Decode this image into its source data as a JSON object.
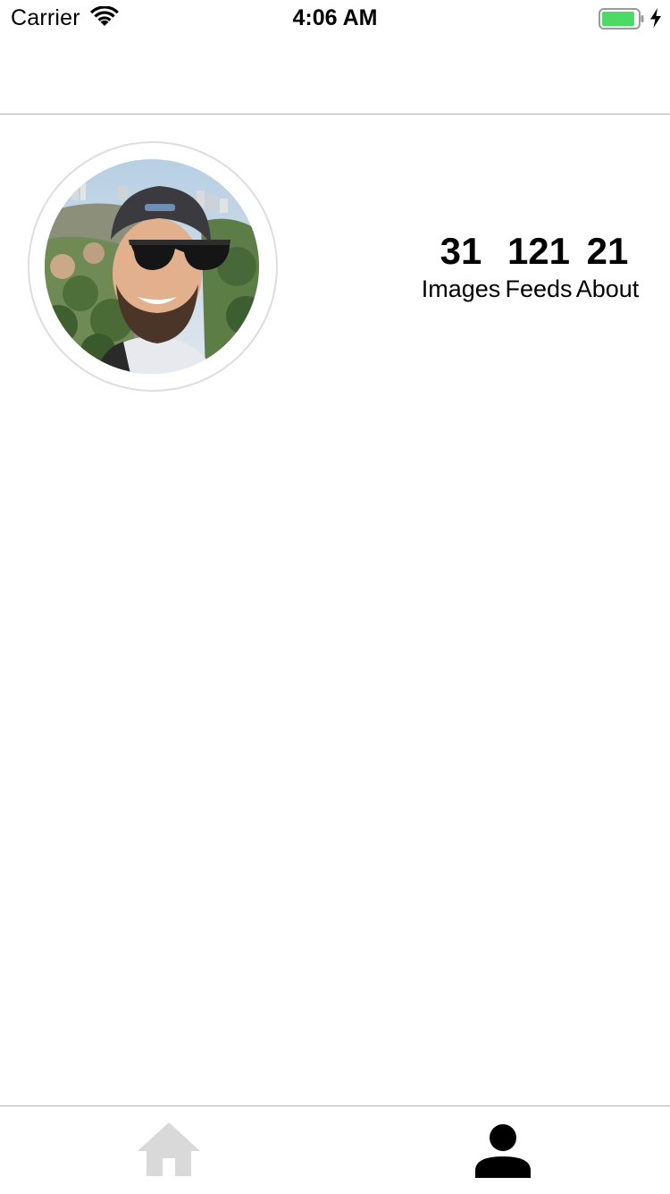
{
  "status_bar": {
    "carrier": "Carrier",
    "time": "4:06 AM",
    "battery_color": "#4cd964"
  },
  "profile": {
    "avatar_alt": "profile photo",
    "stats": [
      {
        "value": "31",
        "label": "Images"
      },
      {
        "value": "121",
        "label": "Feeds"
      },
      {
        "value": "21",
        "label": "About"
      }
    ]
  },
  "tab_bar": {
    "tabs": [
      {
        "icon": "home-icon",
        "active": false
      },
      {
        "icon": "person-icon",
        "active": true
      }
    ],
    "active_color": "#000000",
    "inactive_color": "#d9d9d9"
  }
}
